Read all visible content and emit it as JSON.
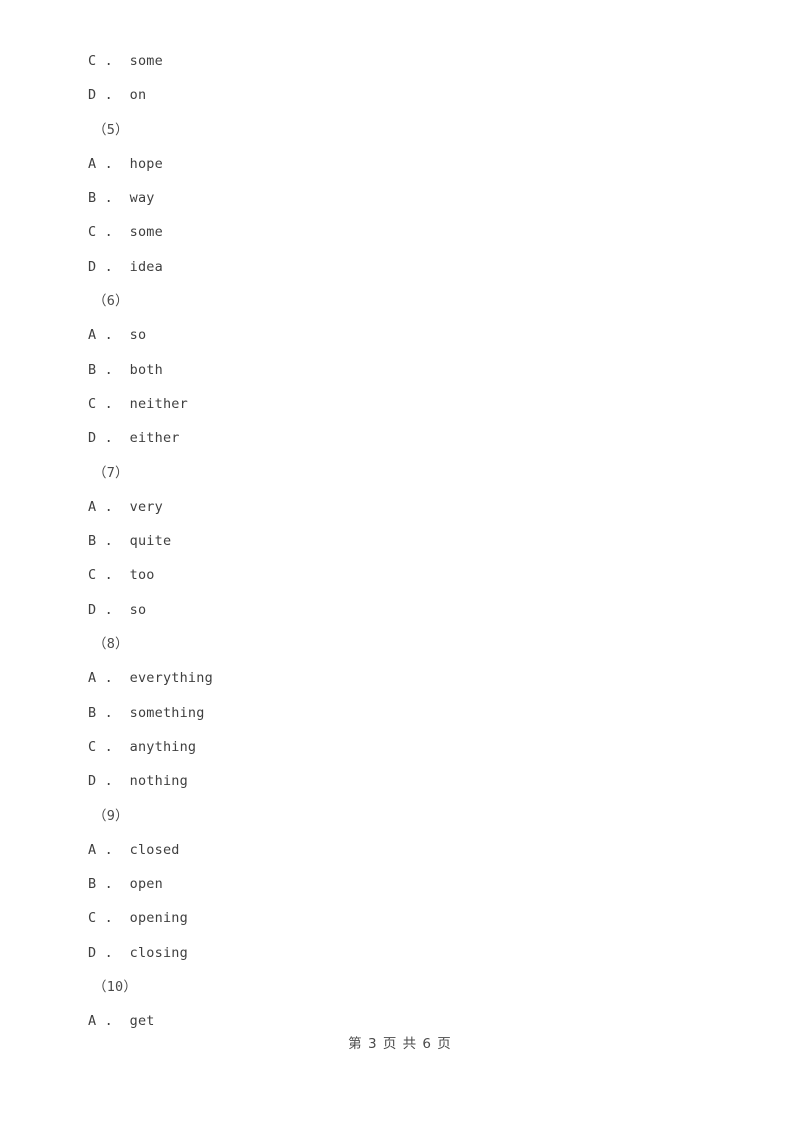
{
  "page": {
    "background_color": "#ffffff",
    "text_color": "#3f3f3f"
  },
  "content": {
    "lines": [
      {
        "kind": "option",
        "letter": "C",
        "separator": " .  ",
        "text": "some",
        "full": "C .  some"
      },
      {
        "kind": "option",
        "letter": "D",
        "separator": " .  ",
        "text": "on",
        "full": "D .  on"
      },
      {
        "kind": "qnum",
        "label": "（5）",
        "full": "（5）"
      },
      {
        "kind": "option",
        "letter": "A",
        "separator": " .  ",
        "text": "hope",
        "full": "A .  hope"
      },
      {
        "kind": "option",
        "letter": "B",
        "separator": " .  ",
        "text": "way",
        "full": "B .  way"
      },
      {
        "kind": "option",
        "letter": "C",
        "separator": " .  ",
        "text": "some",
        "full": "C .  some"
      },
      {
        "kind": "option",
        "letter": "D",
        "separator": " .  ",
        "text": "idea",
        "full": "D .  idea"
      },
      {
        "kind": "qnum",
        "label": "（6）",
        "full": "（6）"
      },
      {
        "kind": "option",
        "letter": "A",
        "separator": " .  ",
        "text": "so",
        "full": "A .  so"
      },
      {
        "kind": "option",
        "letter": "B",
        "separator": " .  ",
        "text": "both",
        "full": "B .  both"
      },
      {
        "kind": "option",
        "letter": "C",
        "separator": " .  ",
        "text": "neither",
        "full": "C .  neither"
      },
      {
        "kind": "option",
        "letter": "D",
        "separator": " .  ",
        "text": "either",
        "full": "D .  either"
      },
      {
        "kind": "qnum",
        "label": "（7）",
        "full": "（7）"
      },
      {
        "kind": "option",
        "letter": "A",
        "separator": " .  ",
        "text": "very",
        "full": "A .  very"
      },
      {
        "kind": "option",
        "letter": "B",
        "separator": " .  ",
        "text": "quite",
        "full": "B .  quite"
      },
      {
        "kind": "option",
        "letter": "C",
        "separator": " .  ",
        "text": "too",
        "full": "C .  too"
      },
      {
        "kind": "option",
        "letter": "D",
        "separator": " .  ",
        "text": "so",
        "full": "D .  so"
      },
      {
        "kind": "qnum",
        "label": "（8）",
        "full": "（8）"
      },
      {
        "kind": "option",
        "letter": "A",
        "separator": " .  ",
        "text": "everything",
        "full": "A .  everything"
      },
      {
        "kind": "option",
        "letter": "B",
        "separator": " .  ",
        "text": "something",
        "full": "B .  something"
      },
      {
        "kind": "option",
        "letter": "C",
        "separator": " .  ",
        "text": "anything",
        "full": "C .  anything"
      },
      {
        "kind": "option",
        "letter": "D",
        "separator": " .  ",
        "text": "nothing",
        "full": "D .  nothing"
      },
      {
        "kind": "qnum",
        "label": "（9）",
        "full": "（9）"
      },
      {
        "kind": "option",
        "letter": "A",
        "separator": " .  ",
        "text": "closed",
        "full": "A .  closed"
      },
      {
        "kind": "option",
        "letter": "B",
        "separator": " .  ",
        "text": "open",
        "full": "B .  open"
      },
      {
        "kind": "option",
        "letter": "C",
        "separator": " .  ",
        "text": "opening",
        "full": "C .  opening"
      },
      {
        "kind": "option",
        "letter": "D",
        "separator": " .  ",
        "text": "closing",
        "full": "D .  closing"
      },
      {
        "kind": "qnum",
        "label": "（10）",
        "full": "（10）"
      },
      {
        "kind": "option",
        "letter": "A",
        "separator": " .  ",
        "text": "get",
        "full": "A .  get"
      }
    ]
  },
  "footer": {
    "page_indicator": "第 3 页 共 6 页",
    "current_page": "3",
    "total_pages": "6"
  }
}
